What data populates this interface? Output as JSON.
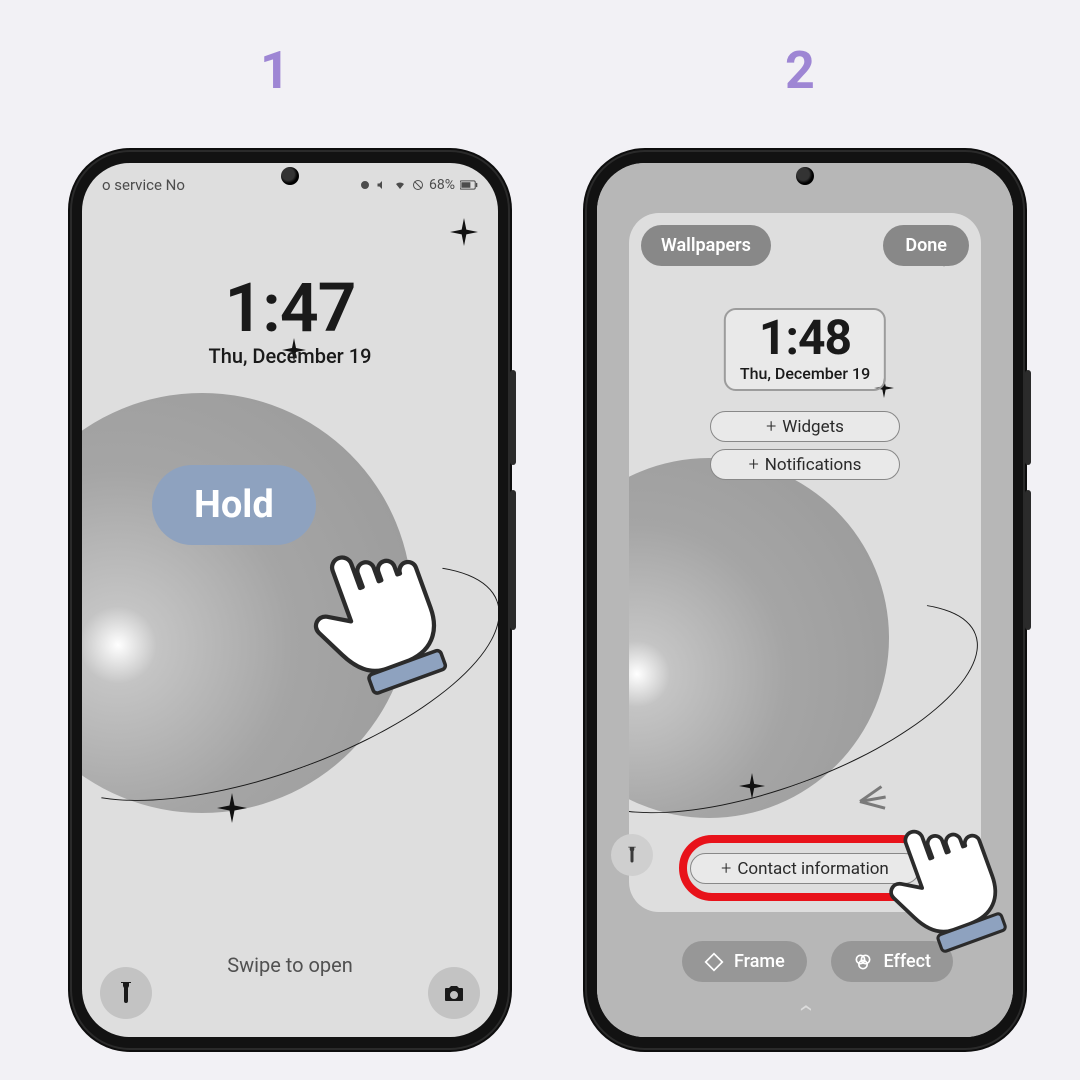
{
  "steps": {
    "one": "1",
    "two": "2"
  },
  "screen1": {
    "status_left": "o service    No",
    "battery_pct": "68%",
    "time": "1:47",
    "date": "Thu, December 19",
    "swipe_text": "Swipe to open",
    "hold_label": "Hold"
  },
  "screen2": {
    "wallpapers_label": "Wallpapers",
    "done_label": "Done",
    "time": "1:48",
    "date": "Thu, December 19",
    "widgets_label": "Widgets",
    "notifications_label": "Notifications",
    "contact_label": "Contact information",
    "frame_label": "Frame",
    "effect_label": "Effect"
  }
}
